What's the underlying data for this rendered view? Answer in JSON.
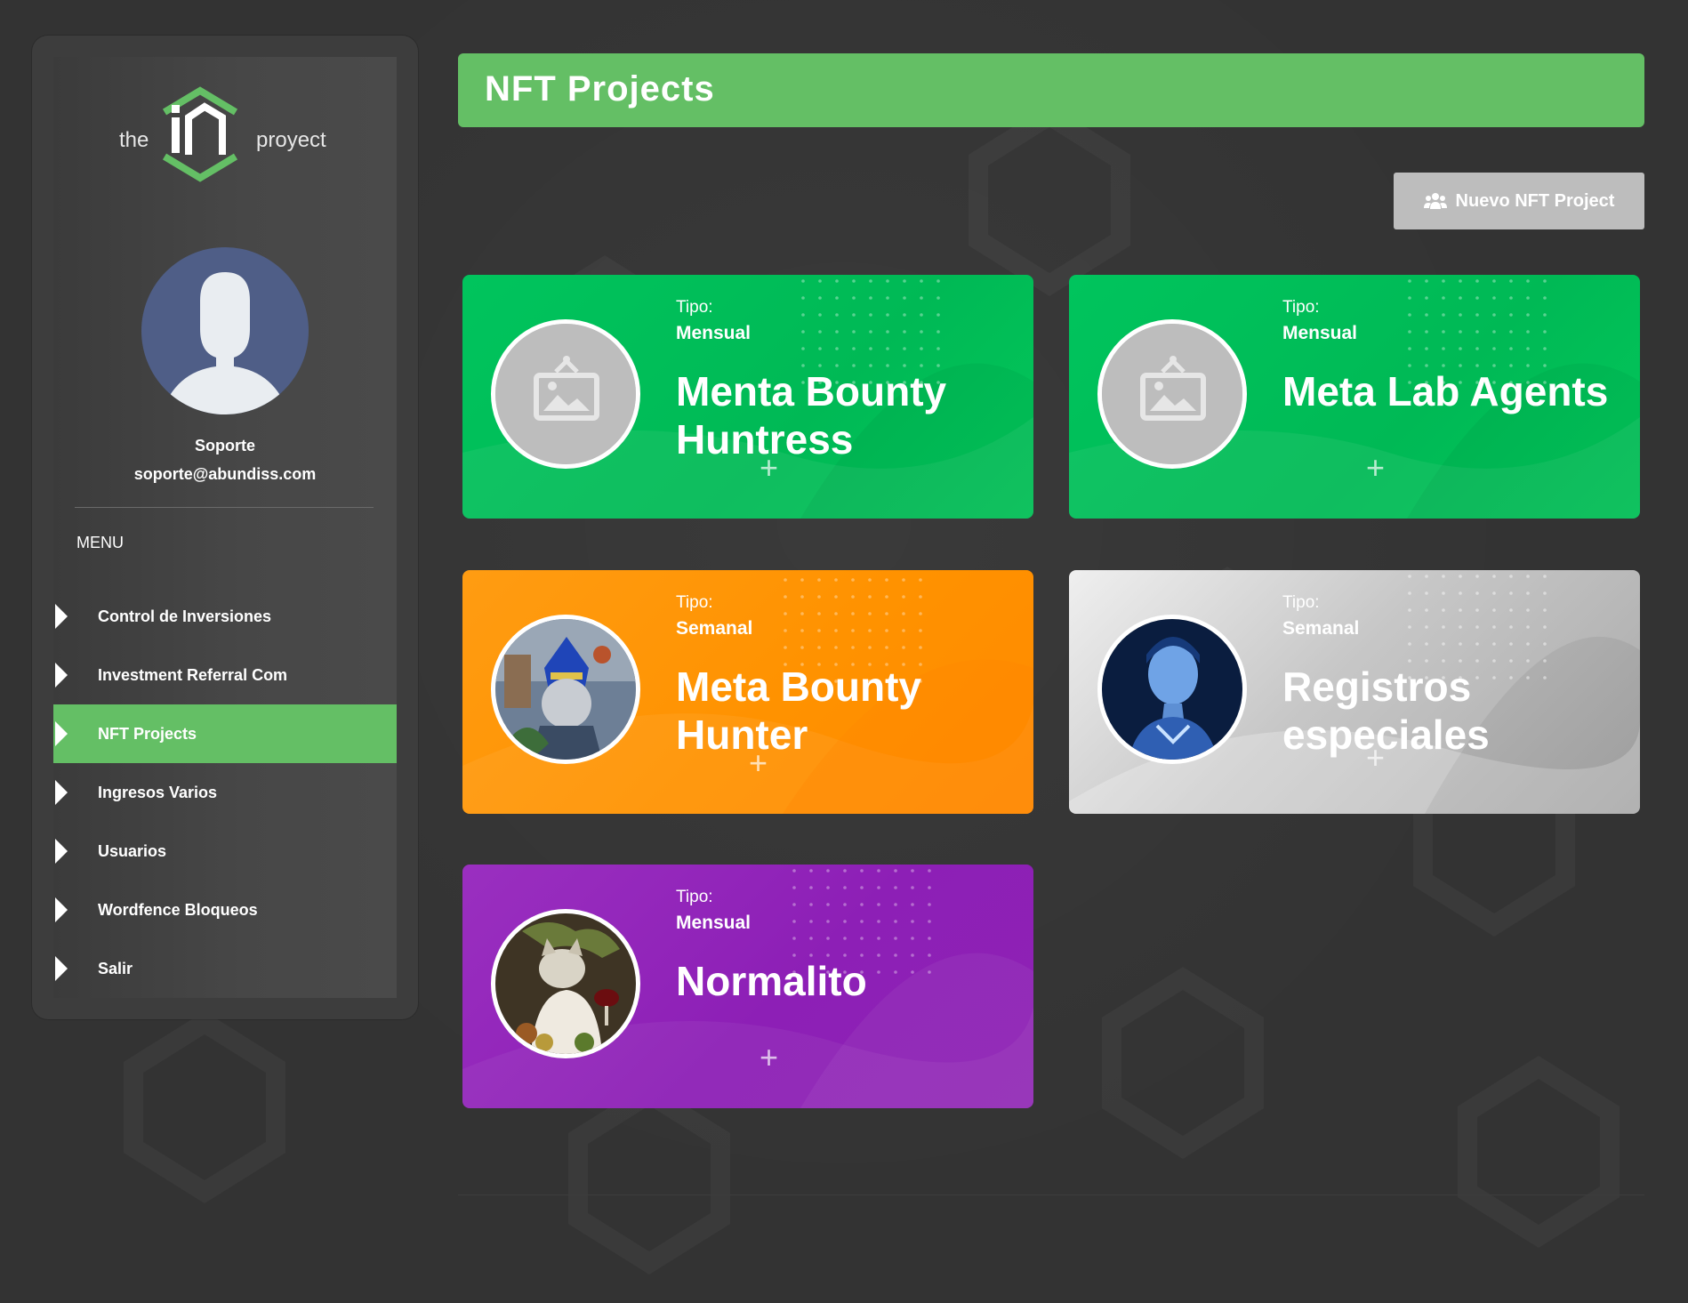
{
  "logo": {
    "left_text": "the",
    "right_text": "proyect",
    "accent": "#64bf65"
  },
  "user": {
    "name": "Soporte",
    "email": "soporte@abundiss.com"
  },
  "menu": {
    "title": "MENU",
    "items": [
      {
        "label": "Control de Inversiones",
        "active": false
      },
      {
        "label": "Investment Referral Com",
        "active": false
      },
      {
        "label": "NFT Projects",
        "active": true
      },
      {
        "label": "Ingresos Varios",
        "active": false
      },
      {
        "label": "Usuarios",
        "active": false
      },
      {
        "label": "Wordfence Bloqueos",
        "active": false
      },
      {
        "label": "Salir",
        "active": false
      }
    ]
  },
  "header": {
    "title": "NFT Projects",
    "color": "#64bf65"
  },
  "new_button": {
    "label": "Nuevo NFT Project",
    "icon": "users-icon"
  },
  "projects": [
    {
      "tipo_label": "Tipo:",
      "tipo": "Mensual",
      "name": "Menta Bounty Huntress",
      "color": "#00c45d",
      "image": "placeholder-image-icon"
    },
    {
      "tipo_label": "Tipo:",
      "tipo": "Mensual",
      "name": "Meta Lab Agents",
      "color": "#00c45d",
      "image": "placeholder-image-icon"
    },
    {
      "tipo_label": "Tipo:",
      "tipo": "Semanal",
      "name": "Meta Bounty Hunter",
      "color": "#ff9200",
      "image": "robot-hunter-avatar"
    },
    {
      "tipo_label": "Tipo:",
      "tipo": "Semanal",
      "name": "Registros especiales",
      "color": "#c7c7c7",
      "image": "blue-woman-avatar"
    },
    {
      "tipo_label": "Tipo:",
      "tipo": "Mensual",
      "name": "Normalito",
      "color": "#8d1fb6",
      "image": "cat-painting-avatar"
    }
  ]
}
